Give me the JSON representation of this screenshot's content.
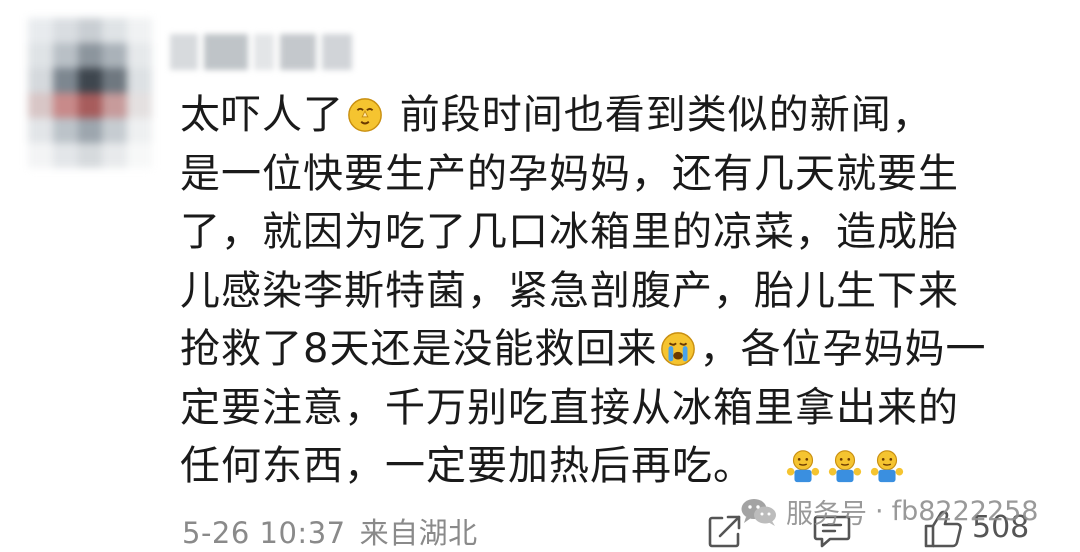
{
  "comment": {
    "lines": [
      {
        "before": "太吓人了",
        "after": " 前段时间也看到类似的新闻，"
      },
      {
        "text": "是一位快要生产的孕妈妈，还有几天就要生"
      },
      {
        "text": "了，就因为吃了几口冰箱里的凉菜，造成胎"
      },
      {
        "text": "儿感染李斯特菌，紧急剖腹产，胎儿生下来"
      },
      {
        "before": "抢救了8天还是没能救回来",
        "after": "，各位孕妈妈一"
      },
      {
        "text": "定要注意，千万别吃直接从冰箱里拿出来的"
      },
      {
        "text": "任何东西，一定要加热后再吃。"
      }
    ],
    "emojis": [
      "praying-face-emoji",
      "crying-face-emoji",
      "shrug-emoji",
      "shrug-emoji",
      "shrug-emoji"
    ]
  },
  "footer": {
    "date_time": "5-26 10:37",
    "location": "来自湖北",
    "like_count": "508"
  },
  "watermark": {
    "account_type": "服务号",
    "separator": "·",
    "account_id": "fb8222258"
  },
  "colors": {
    "text": "#1a1a1a",
    "meta": "#8a8a8a",
    "emoji_yellow": "#f5c430",
    "emoji_blue": "#3a8fe0"
  }
}
